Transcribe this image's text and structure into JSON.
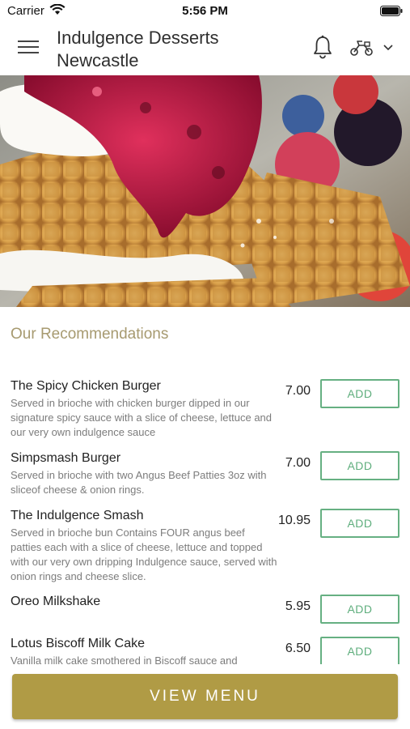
{
  "status_bar": {
    "carrier": "Carrier",
    "time": "5:56 PM"
  },
  "header": {
    "title": "Indulgence Desserts Newcastle"
  },
  "section": {
    "title": "Our Recommendations"
  },
  "menu_items": [
    {
      "name": "The Spicy Chicken Burger",
      "description": "Served in brioche with chicken burger dipped in our signature spicy sauce with a slice of cheese, lettuce and our very own indulgence sauce",
      "price": "7.00",
      "add_label": "ADD"
    },
    {
      "name": "Simpsmash Burger",
      "description": "Served in brioche with two Angus Beef Patties 3oz with sliceof cheese & onion rings.",
      "price": "7.00",
      "add_label": "ADD"
    },
    {
      "name": "The Indulgence Smash",
      "description": "Served in brioche bun Contains FOUR angus beef patties each with a slice of cheese, lettuce and topped with our very own dripping Indulgence sauce, served with onion rings and cheese slice.",
      "price": "10.95",
      "add_label": "ADD"
    },
    {
      "name": "Oreo Milkshake",
      "description": "",
      "price": "5.95",
      "add_label": "ADD"
    },
    {
      "name": "Lotus Biscoff Milk Cake",
      "description": "Vanilla milk cake smothered in Biscoff sauce and",
      "price": "6.50",
      "add_label": "ADD"
    }
  ],
  "footer": {
    "view_menu_label": "VIEW MENU"
  },
  "colors": {
    "accent_gold": "#b09b45",
    "section_title": "#a79a70",
    "add_green": "#5fae7d"
  },
  "icons": [
    "wifi-icon",
    "battery-icon",
    "menu-icon",
    "bell-icon",
    "delivery-icon",
    "chevron-down-icon"
  ]
}
